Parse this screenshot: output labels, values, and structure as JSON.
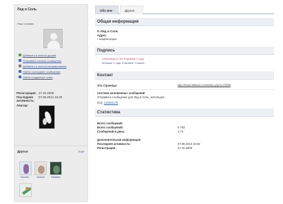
{
  "profile": {
    "name": "Лед и Соль",
    "user_title": "Наш человек",
    "actions": [
      {
        "label": "Добавить в список друзей",
        "color": "#5a9a3a"
      },
      {
        "label": "Отправить личное сообщение",
        "color": "#3a6aca"
      },
      {
        "label": "Добавить в список игнорирования",
        "color": "#7a7a7a"
      },
      {
        "label": "Найти последние сообщения",
        "color": "#3a6aca"
      },
      {
        "label": "Найти созданные темы",
        "color": "#3a6aca"
      }
    ],
    "stats": {
      "registration_label": "Регистрация:",
      "registration_value": "27.10.2008",
      "last_activity_label": "Последняя активность:",
      "last_activity_value": "07.08.2012 18:48",
      "avatar_label": "Аватар:"
    }
  },
  "friends": {
    "title": "Друзья",
    "all_link": "Ещё",
    "items": [
      {
        "name": "Оксана..."
      },
      {
        "name": "Анечка"
      },
      {
        "name": "Кабуйка"
      },
      {
        "name": ""
      }
    ]
  },
  "tabs": {
    "active": "Обо мне",
    "inactive": "Друзья"
  },
  "about": {
    "section_title": "Общая информация",
    "heading": "О Лед и Соль",
    "address_label": "Адрес:",
    "address_value": "г. Академгородок"
  },
  "signature": {
    "section_title": "Подпись",
    "line1": "Алексеечку 5 лет, Елисейке 2 года",
    "line2": "Антошке 2 года, Елисейке 1 шкала"
  },
  "contact": {
    "section_title": "Контакт",
    "page_label": "Эта страница:",
    "page_value": "http://forum.littleone.ru/member.php?u=23556",
    "im_title": "Система мгновенных сообщений",
    "im_text": "Отправить сообщение для Лед и Соль, используя...",
    "icq_label": "ICQ:",
    "icq_value": "145491176"
  },
  "statistics": {
    "section_title": "Статистика",
    "total_title": "Всего сообщений",
    "total_label": "Всего сообщений:",
    "total_value": "5 793",
    "per_day_label": "Сообщений в день:",
    "per_day_value": "2,74",
    "extra_title": "Дополнительная информация",
    "last_activity_label": "Последняя активность:",
    "last_activity_value": "07.08.2012 18:48",
    "registration_label": "Регистрация:",
    "registration_value": "27.10.2008"
  }
}
